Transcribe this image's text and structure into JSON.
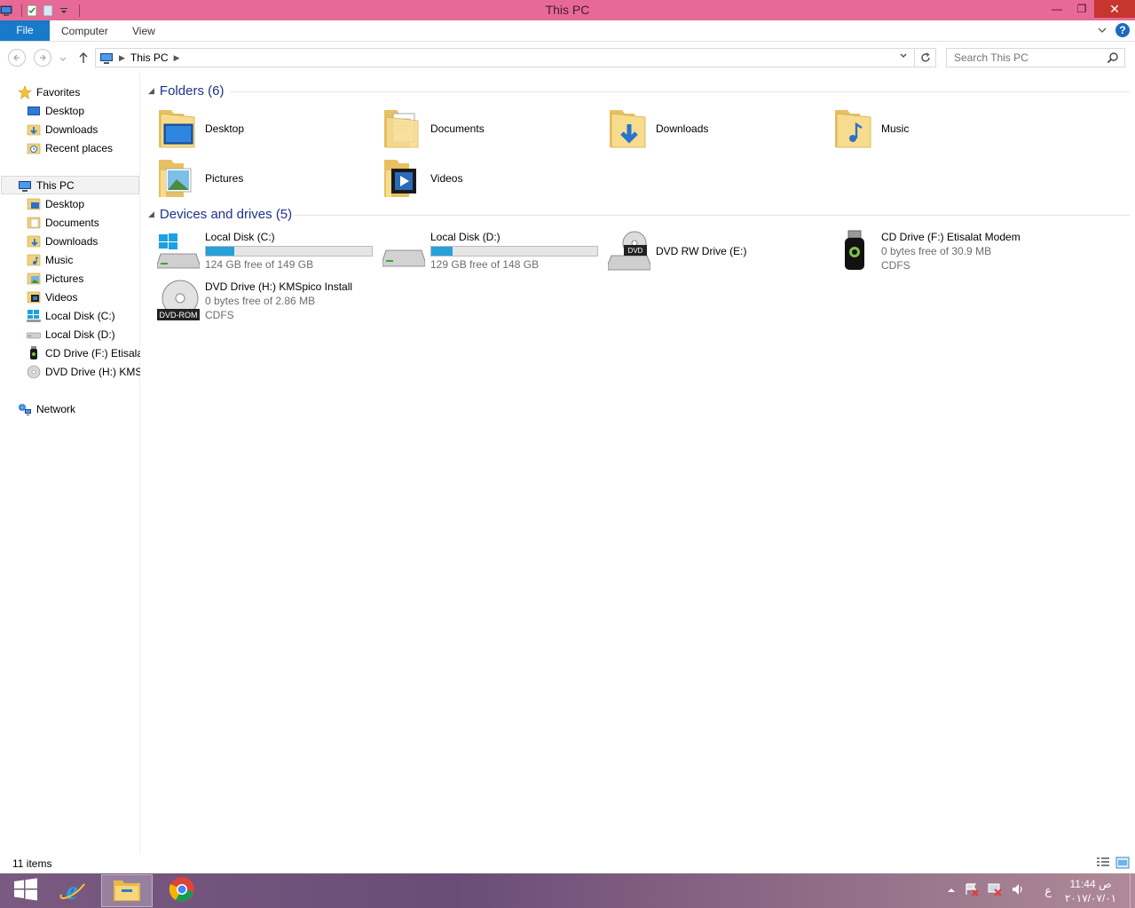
{
  "window": {
    "title": "This PC",
    "minimize_glyph": "—",
    "restore_glyph": "❐",
    "close_glyph": "✕"
  },
  "ribbon": {
    "tabs": [
      "File",
      "Computer",
      "View"
    ],
    "help_glyph": "?"
  },
  "address": {
    "path": "This PC",
    "search_placeholder": "Search This PC"
  },
  "nav": {
    "favorites": {
      "label": "Favorites",
      "items": [
        "Desktop",
        "Downloads",
        "Recent places"
      ]
    },
    "this_pc": {
      "label": "This PC",
      "items": [
        "Desktop",
        "Documents",
        "Downloads",
        "Music",
        "Pictures",
        "Videos",
        "Local Disk (C:)",
        "Local Disk (D:)",
        "CD Drive (F:) Etisalat Modem",
        "DVD Drive (H:) KMSpico Install"
      ]
    },
    "network": {
      "label": "Network"
    }
  },
  "folders": {
    "header": "Folders (6)",
    "items": [
      "Desktop",
      "Documents",
      "Downloads",
      "Music",
      "Pictures",
      "Videos"
    ]
  },
  "devices": {
    "header": "Devices and drives (5)",
    "items": [
      {
        "name": "Local Disk (C:)",
        "sub": "124 GB free of 149 GB",
        "used_fraction": 0.17
      },
      {
        "name": "Local Disk (D:)",
        "sub": "129 GB free of 148 GB",
        "used_fraction": 0.13
      },
      {
        "name": "DVD RW Drive (E:)"
      },
      {
        "name": "CD Drive (F:) Etisalat Modem",
        "sub": "0 bytes free of 30.9 MB",
        "fs": "CDFS"
      },
      {
        "name": "DVD Drive (H:) KMSpico Install",
        "sub": "0 bytes free of 2.86 MB",
        "fs": "CDFS"
      }
    ],
    "dvd_badge": "DVD",
    "dvdrom_badge": "DVD-ROM"
  },
  "status": {
    "count": "11 items"
  },
  "taskbar": {
    "time": "11:44 ص",
    "date": "٢٠١٧/٠٧/٠١",
    "lang": "ع"
  },
  "colors": {
    "titlebar": "#e66a95",
    "file_tab": "#1979ca",
    "group_header": "#1e3287",
    "progress": "#26a0da"
  }
}
